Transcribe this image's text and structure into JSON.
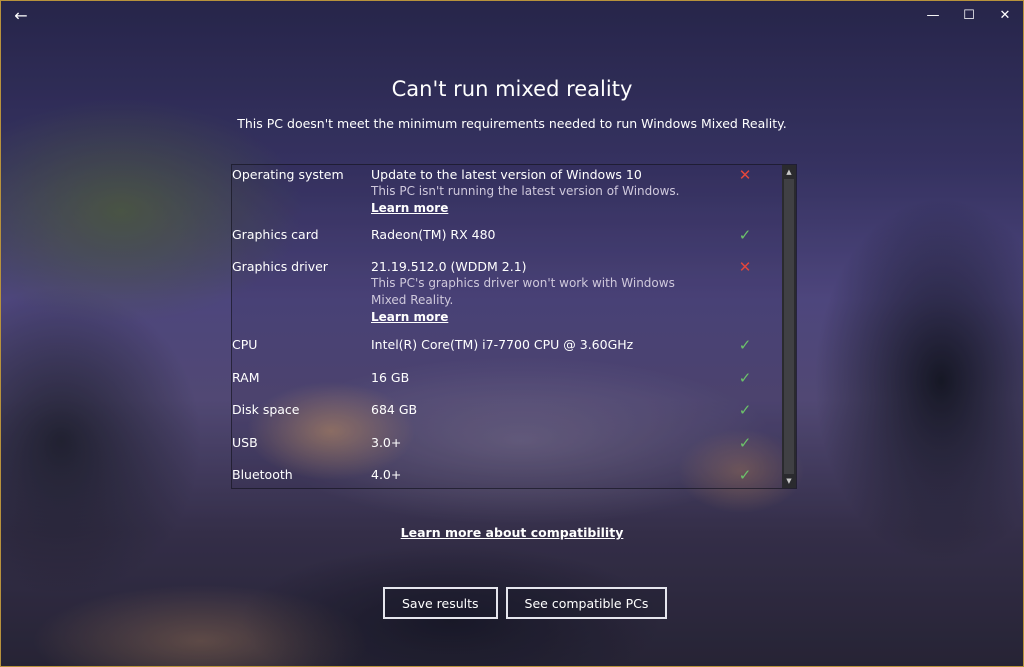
{
  "titlebar": {
    "back_glyph": "←",
    "minimize_glyph": "—",
    "maximize_glyph": "☐",
    "close_glyph": "✕"
  },
  "header": {
    "title": "Can't run mixed reality",
    "subtitle": "This PC doesn't meet the minimum requirements needed to run Windows Mixed Reality."
  },
  "requirements": [
    {
      "label": "Operating system",
      "value": "Update to the latest version of Windows 10",
      "detail": "This PC isn't running the latest version of Windows.",
      "link": "Learn more",
      "status": "fail",
      "status_icon": "x-icon"
    },
    {
      "label": "Graphics card",
      "value": "Radeon(TM) RX 480",
      "status": "pass",
      "status_icon": "check-icon"
    },
    {
      "label": "Graphics driver",
      "value": "21.19.512.0 (WDDM 2.1)",
      "detail": "This PC's graphics driver won't work with Windows Mixed Reality.",
      "link": "Learn more",
      "status": "fail",
      "status_icon": "x-icon"
    },
    {
      "label": "CPU",
      "value": "Intel(R) Core(TM) i7-7700 CPU @ 3.60GHz",
      "status": "pass",
      "status_icon": "check-icon"
    },
    {
      "label": "RAM",
      "value": "16 GB",
      "status": "pass",
      "status_icon": "check-icon"
    },
    {
      "label": "Disk space",
      "value": "684 GB",
      "status": "pass",
      "status_icon": "check-icon"
    },
    {
      "label": "USB",
      "value": "3.0+",
      "status": "pass",
      "status_icon": "check-icon"
    },
    {
      "label": "Bluetooth",
      "value": "4.0+",
      "status": "pass",
      "status_icon": "check-icon"
    }
  ],
  "status_glyphs": {
    "fail": "✕",
    "pass": "✓"
  },
  "colors": {
    "fail": "#e2463c",
    "pass": "#6cc26a",
    "window_border": "#b8923c"
  },
  "compat_link": "Learn more about compatibility",
  "buttons": {
    "save": "Save results",
    "see_pcs": "See compatible PCs"
  }
}
